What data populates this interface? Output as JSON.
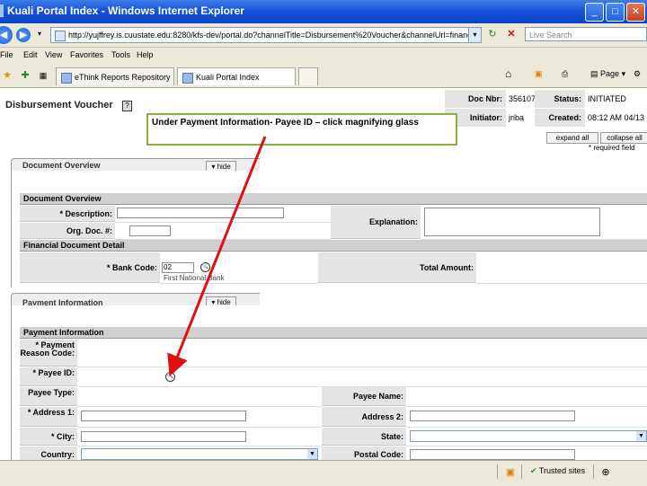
{
  "window": {
    "title": "Kuali Portal Index - Windows Internet Explorer"
  },
  "address_bar": {
    "url": "http://yujffrey.is.cuustate.edu:8280/kfs-dev/portal.do?channelTitle=Disbursement%20Voucher&channelUrl=financialDisburseme",
    "search_placeholder": "Live Search"
  },
  "menu": [
    "File",
    "Edit",
    "View",
    "Favorites",
    "Tools",
    "Help"
  ],
  "tabs": [
    {
      "label": "eThink Reports Repository"
    },
    {
      "label": "Kuali Portal Index"
    }
  ],
  "toolbar": {
    "page_label": "Page"
  },
  "doc_header": {
    "doc_nbr_label": "Doc Nbr:",
    "doc_nbr": "356107",
    "status_label": "Status:",
    "status": "INITIATED",
    "initiator_label": "Initiator:",
    "initiator": "jriba",
    "created_label": "Created:",
    "created": "08:12 AM 04/13"
  },
  "page": {
    "title": "Disbursement Voucher",
    "expand_all": "expand all",
    "collapse_all": "collapse all",
    "required_note": "* required field"
  },
  "callout": {
    "text": "Under Payment Information- Payee ID – click magnifying glass"
  },
  "document_overview": {
    "tab_label": "Document Overview",
    "hide_label": "hide",
    "section_title": "Document Overview",
    "description_label": "* Description:",
    "org_doc_label": "Org. Doc. #:",
    "explanation_label": "Explanation:",
    "financial_title": "Financial Document Detail",
    "bank_code_label": "* Bank Code:",
    "bank_code_value": "02",
    "bank_name": "First National Bank",
    "total_amount_label": "Total Amount:"
  },
  "payment_information": {
    "tab_label": "Payment Information",
    "hide_label": "hide",
    "section_title": "Payment Information",
    "reason_label": "* Payment Reason Code:",
    "payee_id_label": "* Payee ID:",
    "payee_type_label": "Payee Type:",
    "payee_name_label": "Payee Name:",
    "address1_label": "* Address 1:",
    "address2_label": "Address 2:",
    "city_label": "* City:",
    "state_label": "State:",
    "country_label": "Country:",
    "postal_label": "Postal Code:"
  },
  "status_bar": {
    "zone": "Trusted sites"
  },
  "colors": {
    "title_bar": "#1653d6",
    "callout_border": "#8ab040",
    "arrow": "#e01010"
  }
}
